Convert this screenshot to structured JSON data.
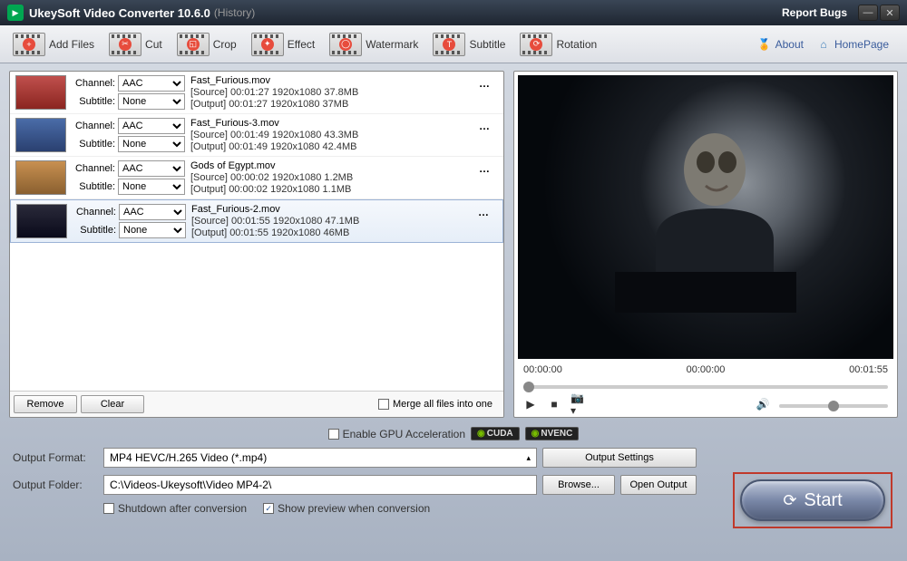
{
  "app": {
    "title": "UkeySoft Video Converter 10.6.0",
    "history": "(History)",
    "report": "Report Bugs"
  },
  "toolbar": {
    "add_files": "Add Files",
    "cut": "Cut",
    "crop": "Crop",
    "effect": "Effect",
    "watermark": "Watermark",
    "subtitle": "Subtitle",
    "rotation": "Rotation",
    "about": "About",
    "homepage": "HomePage"
  },
  "files": [
    {
      "channel_label": "Channel:",
      "channel": "AAC",
      "subtitle_label": "Subtitle:",
      "subtitle": "None",
      "filename": "Fast_Furious.mov",
      "source": "[Source]  00:01:27  1920x1080  37.8MB",
      "output": "[Output]  00:01:27  1920x1080  37MB",
      "thumb": "red"
    },
    {
      "channel_label": "Channel:",
      "channel": "AAC",
      "subtitle_label": "Subtitle:",
      "subtitle": "None",
      "filename": "Fast_Furious-3.mov",
      "source": "[Source]  00:01:49  1920x1080  43.3MB",
      "output": "[Output]  00:01:49  1920x1080  42.4MB",
      "thumb": "blue"
    },
    {
      "channel_label": "Channel:",
      "channel": "AAC",
      "subtitle_label": "Subtitle:",
      "subtitle": "None",
      "filename": "Gods of Egypt.mov",
      "source": "[Source]  00:00:02  1920x1080  1.2MB",
      "output": "[Output]  00:00:02  1920x1080  1.1MB",
      "thumb": "gold"
    },
    {
      "channel_label": "Channel:",
      "channel": "AAC",
      "subtitle_label": "Subtitle:",
      "subtitle": "None",
      "filename": "Fast_Furious-2.mov",
      "source": "[Source]  00:01:55  1920x1080  47.1MB",
      "output": "[Output]  00:01:55  1920x1080  46MB",
      "thumb": "dark",
      "selected": true
    }
  ],
  "list_buttons": {
    "remove": "Remove",
    "clear": "Clear",
    "merge": "Merge all files into one"
  },
  "preview": {
    "t1": "00:00:00",
    "t2": "00:00:00",
    "t3": "00:01:55"
  },
  "gpu": {
    "label": "Enable GPU Acceleration",
    "cuda": "CUDA",
    "nvenc": "NVENC"
  },
  "output": {
    "format_label": "Output Format:",
    "format_value": "MP4 HEVC/H.265 Video (*.mp4)",
    "settings": "Output Settings",
    "folder_label": "Output Folder:",
    "folder_value": "C:\\Videos-Ukeysoft\\Video MP4-2\\",
    "browse": "Browse...",
    "open": "Open Output"
  },
  "options": {
    "shutdown": "Shutdown after conversion",
    "preview": "Show preview when conversion"
  },
  "start": "Start"
}
